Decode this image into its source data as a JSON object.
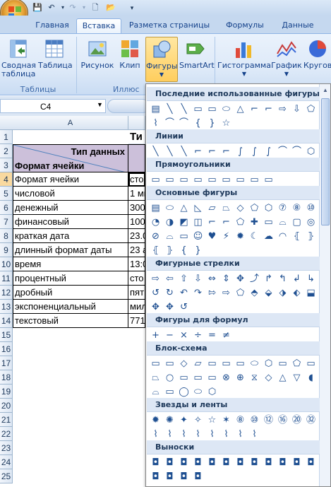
{
  "colors": {
    "accent": "#15428b",
    "ribbon": "#dde9f8",
    "selected_tab": "#ffffff",
    "selected_button": "#ffce5e"
  },
  "qat": {
    "icons": [
      "save-icon",
      "undo-icon",
      "redo-icon",
      "new-document-icon",
      "open-icon",
      "customize-icon"
    ]
  },
  "tabs": [
    "Главная",
    "Вставка",
    "Разметка страницы",
    "Формулы",
    "Данные"
  ],
  "ribbon": {
    "buttons": {
      "pivot": "Сводная таблица",
      "table": "Таблица",
      "picture": "Рисунок",
      "clip": "Клип",
      "shapes": "Фигуры",
      "smartart": "SmartArt",
      "histogram": "Гистограмма",
      "graph": "График",
      "pie": "Кругова"
    },
    "groups": {
      "tables": "Таблицы",
      "illustrations": "Иллюс"
    }
  },
  "formula_bar": {
    "namebox": "C4"
  },
  "sheet": {
    "col_a": "A",
    "rows": [
      "1",
      "2",
      "3",
      "4",
      "5",
      "6",
      "7",
      "8",
      "9",
      "10",
      "11",
      "12",
      "13",
      "14",
      "15",
      "16",
      "17",
      "18",
      "19",
      "20",
      "21",
      "22",
      "23",
      "24",
      "25"
    ],
    "title_partial": "Ти",
    "header_type": "Тип данных",
    "header_format": "Формат ячейки",
    "col_a_values": [
      "Формат ячейки",
      "числовой",
      "денежный",
      "финансовый",
      "краткая дата",
      "длинный формат даты",
      "время",
      "процентный",
      "дробный",
      "экспоненциальный",
      "текстовый"
    ],
    "col_c_values": [
      "сто",
      "1 ми",
      "3000",
      "1000",
      "23.0",
      "23 а",
      "13:0",
      "сто",
      "пят",
      "мил",
      "771"
    ]
  },
  "shapes_panel": {
    "sections": {
      "recent": "Последние использованные фигуры",
      "lines": "Линии",
      "rectangles": "Прямоугольники",
      "basic": "Основные фигуры",
      "arrows": "Фигурные стрелки",
      "equations": "Фигуры для формул",
      "flowchart": "Блок-схема",
      "stars": "Звезды и ленты",
      "callouts": "Выноски"
    },
    "glyphs": {
      "recent": [
        "▤",
        "╲",
        "╲",
        "▭",
        "▭",
        "⬭",
        "△",
        "⌐",
        "⌐",
        "⇨",
        "⇩",
        "⬠",
        "⌇",
        "⌒",
        "⌒",
        "{",
        "}",
        "☆"
      ],
      "lines": [
        "╲",
        "╲",
        "╲",
        "⌐",
        "⌐",
        "⌐",
        "∫",
        "∫",
        "∫",
        "⌒",
        "⌒",
        "⬡"
      ],
      "rectangles": [
        "▭",
        "▭",
        "▭",
        "▭",
        "▭",
        "▭",
        "▭",
        "▭",
        "▭"
      ],
      "basic": [
        "▤",
        "⬭",
        "△",
        "◺",
        "▱",
        "⏢",
        "◇",
        "⬠",
        "⬡",
        "⑦",
        "⑧",
        "⑩",
        "◔",
        "◑",
        "◩",
        "◫",
        "⌐",
        "⌐",
        "⬠",
        "✚",
        "▭",
        "⌓",
        "▢",
        "◎",
        "⊘",
        "⌓",
        "▭",
        "☺",
        "♥",
        "⚡",
        "✹",
        "☾",
        "☁",
        "◠",
        "⦃",
        "⦄",
        "⦃",
        "⦄",
        "{",
        "}"
      ],
      "arrows": [
        "⇨",
        "⇦",
        "⇧",
        "⇩",
        "⇔",
        "⇕",
        "✥",
        "⤴",
        "↱",
        "↰",
        "↲",
        "↳",
        "↺",
        "↻",
        "↶",
        "↷",
        "⇰",
        "⇨",
        "⬠",
        "⬘",
        "⬙",
        "⬗",
        "⬖",
        "⬓",
        "✥",
        "✥",
        "↺"
      ],
      "equations": [
        "+",
        "−",
        "×",
        "÷",
        "=",
        "≠"
      ],
      "flowchart": [
        "▭",
        "▭",
        "◇",
        "▱",
        "▭",
        "▭",
        "▭",
        "⬭",
        "⬡",
        "▭",
        "⬠",
        "▭",
        "⏢",
        "○",
        "▭",
        "▭",
        "▭",
        "⊗",
        "⊕",
        "⧖",
        "◇",
        "△",
        "▽",
        "◖",
        "⌓",
        "▭",
        "◯",
        "⬭",
        "⬡"
      ],
      "stars": [
        "✹",
        "✺",
        "✦",
        "✧",
        "☆",
        "✶",
        "⑧",
        "⑩",
        "⑫",
        "⑯",
        "⑳",
        "㉜",
        "⌇",
        "⌇",
        "⌇",
        "⌇",
        "⌇",
        "⌇",
        "⌇",
        "⌇"
      ],
      "callouts": [
        "◘",
        "◘",
        "◘",
        "◘",
        "◘",
        "◘",
        "◘",
        "◘",
        "◘",
        "◘",
        "◘",
        "◘",
        "◘",
        "◘",
        "◘",
        "◘"
      ]
    }
  }
}
